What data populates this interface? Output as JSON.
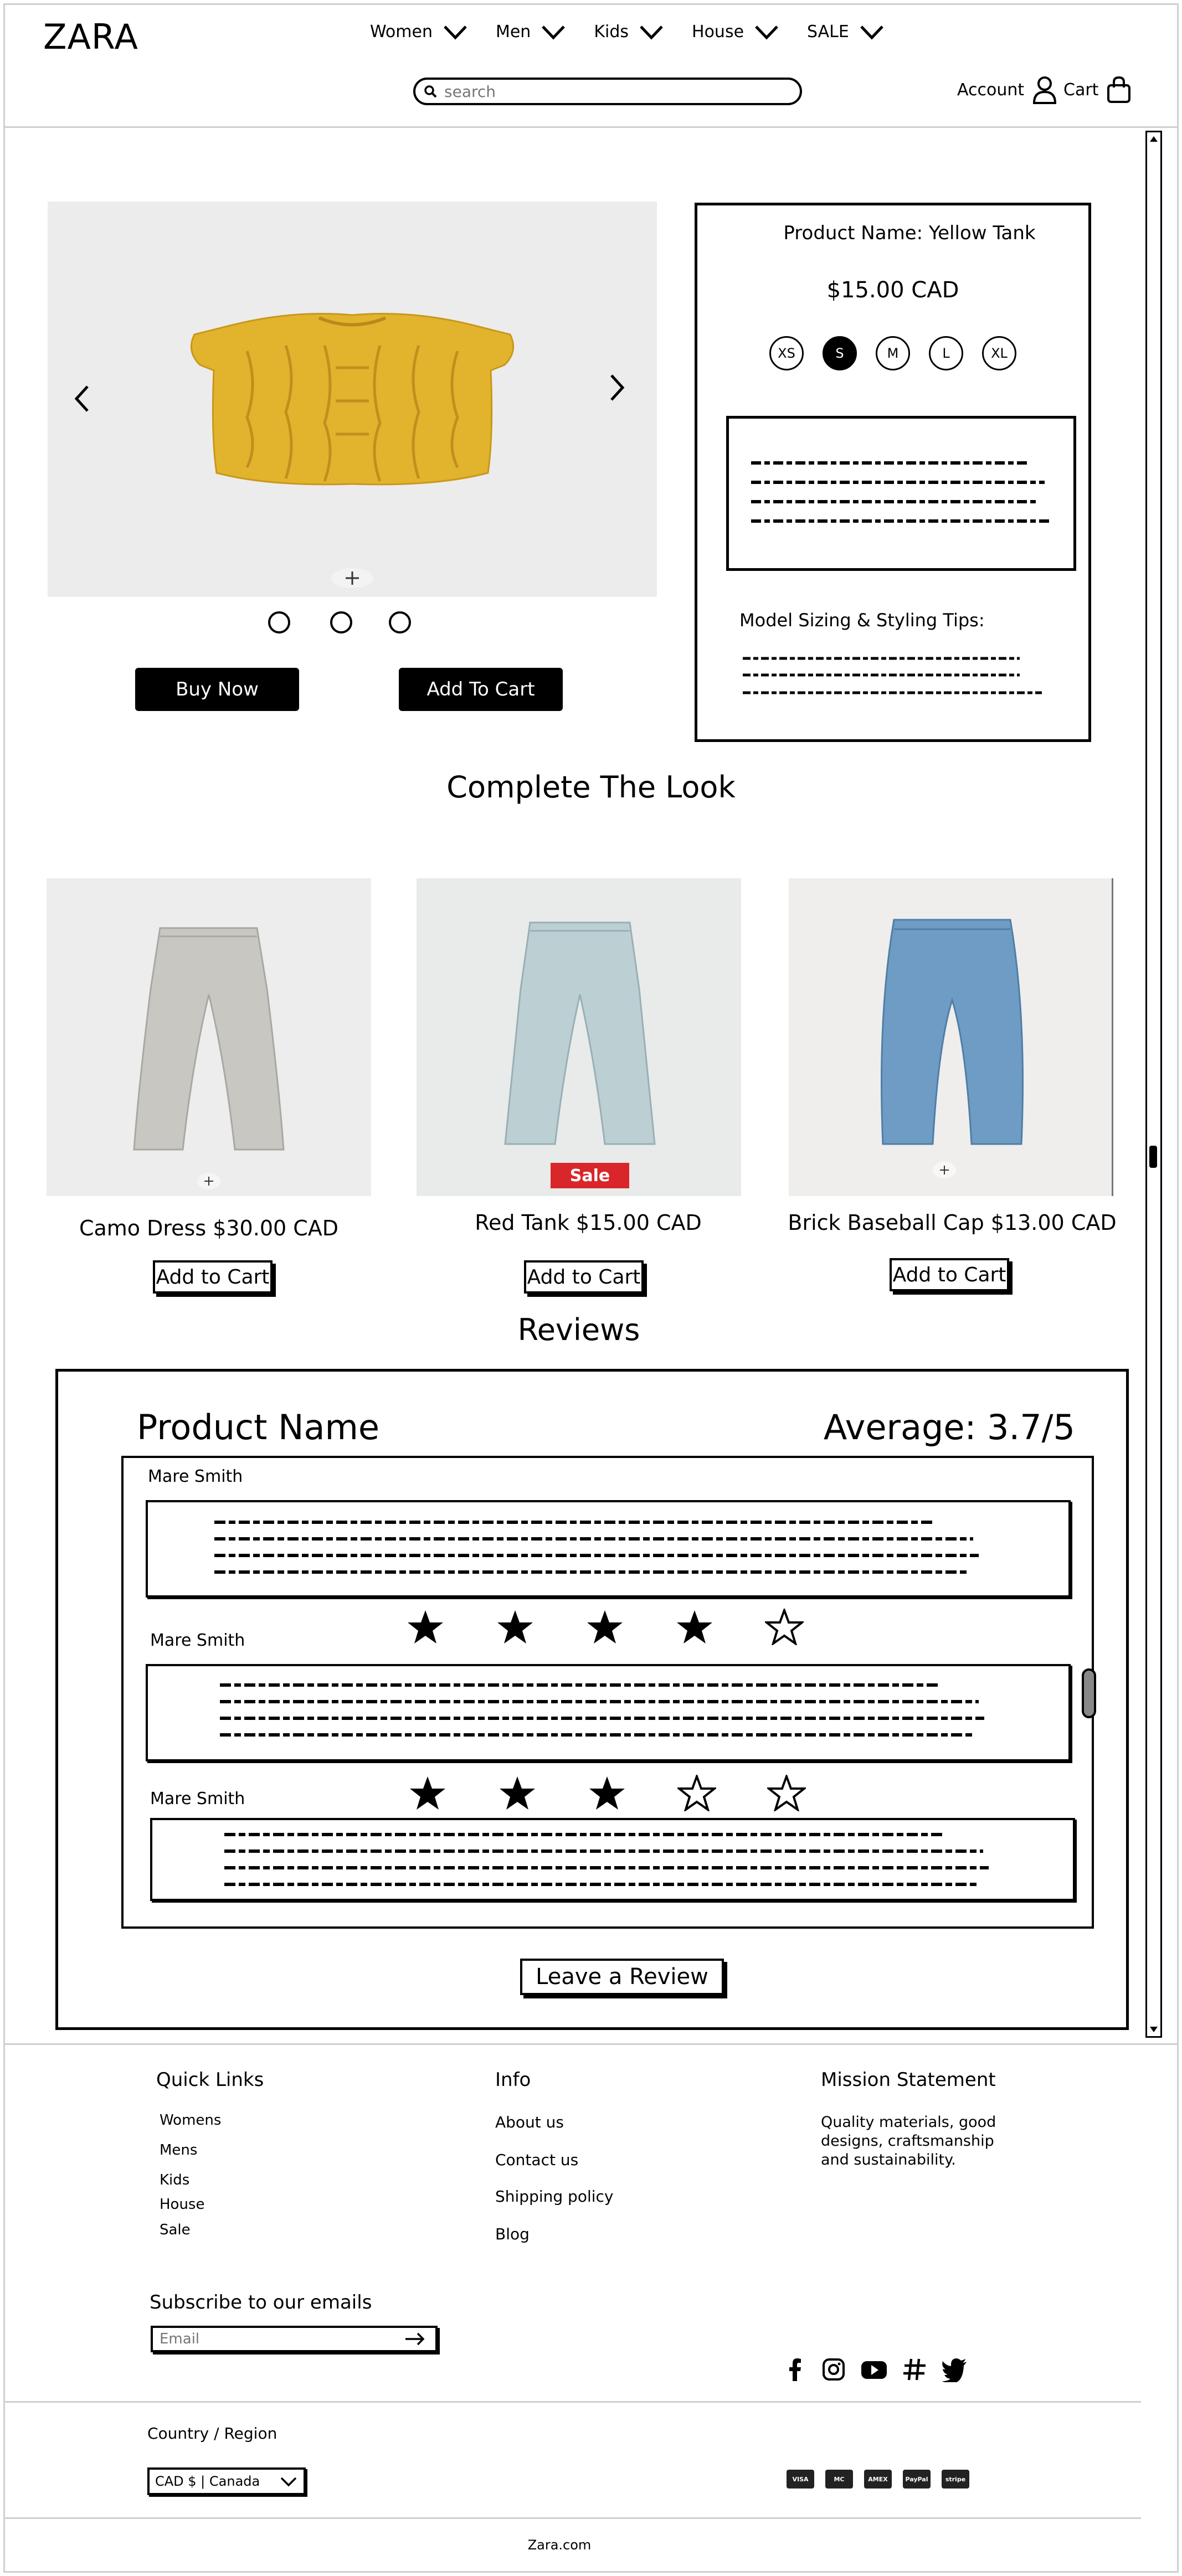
{
  "header": {
    "logo": "ZARA",
    "nav": [
      "Women",
      "Men",
      "Kids",
      "House",
      "SALE"
    ],
    "search_placeholder": "search",
    "account_label": "Account",
    "cart_label": "Cart"
  },
  "product": {
    "name_label": "Product Name: Yellow Tank",
    "price": "$15.00 CAD",
    "sizes": [
      "XS",
      "S",
      "M",
      "L",
      "XL"
    ],
    "selected_size": "S",
    "styling_title": "Model Sizing & Styling Tips:",
    "buy_now": "Buy Now",
    "add_to_cart": "Add To Cart"
  },
  "complete_look": {
    "title": "Complete The Look",
    "items": [
      {
        "label": "Camo Dress $30.00 CAD",
        "button": "Add to Cart"
      },
      {
        "label": "Red Tank $15.00 CAD",
        "button": "Add to Cart",
        "badge": "Sale"
      },
      {
        "label": "Brick Baseball Cap $13.00 CAD",
        "button": "Add to Cart"
      }
    ]
  },
  "reviews": {
    "title": "Reviews",
    "product_name": "Product Name",
    "average": "Average: 3.7/5",
    "items": [
      {
        "author": "Mare Smith",
        "rating": 4
      },
      {
        "author": "Mare Smith",
        "rating": 3
      },
      {
        "author": "Mare Smith"
      }
    ],
    "leave_review": "Leave a Review"
  },
  "footer": {
    "quick_links_title": "Quick Links",
    "quick_links": [
      "Womens",
      "Mens",
      "Kids",
      "House",
      "Sale"
    ],
    "info_title": "Info",
    "info_links": [
      "About us",
      "Contact us",
      "Shipping policy",
      "Blog"
    ],
    "mission_title": "Mission Statement",
    "mission_text": "Quality materials, good designs, craftsmanship and sustainability.",
    "subscribe_title": "Subscribe to our emails",
    "email_placeholder": "Email",
    "region_title": "Country / Region",
    "region_value": "CAD $ | Canada",
    "social_icons": [
      "facebook-icon",
      "instagram-icon",
      "youtube-icon",
      "hashtag-icon",
      "twitter-icon"
    ],
    "payments": [
      "VISA",
      "MC",
      "AMEX",
      "PayPal",
      "stripe"
    ],
    "copyright": "Zara.com"
  },
  "colors": {
    "sale": "#d9262a",
    "yellow": "#e3b52a",
    "denim_light": "#b9cfd6",
    "denim_mid": "#6f9bc3"
  }
}
